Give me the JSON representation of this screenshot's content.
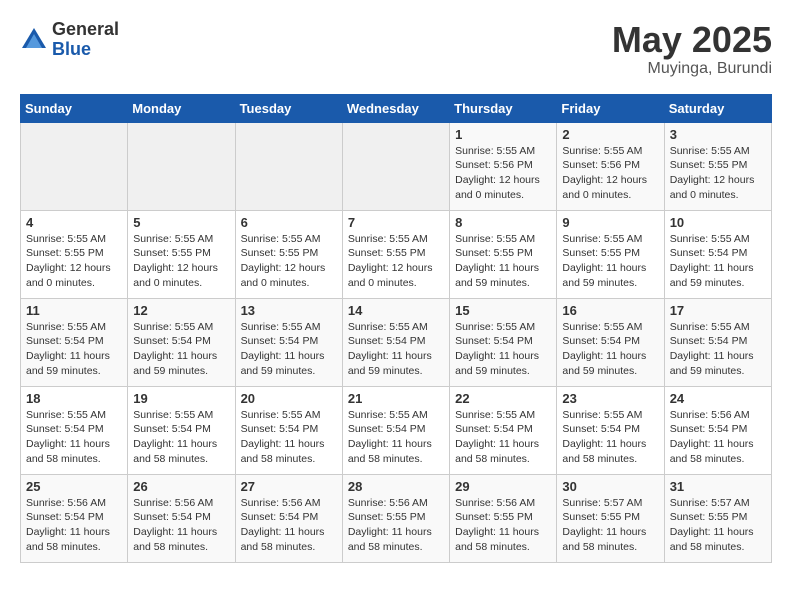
{
  "header": {
    "logo": {
      "general": "General",
      "blue": "Blue"
    },
    "month": "May 2025",
    "location": "Muyinga, Burundi"
  },
  "weekdays": [
    "Sunday",
    "Monday",
    "Tuesday",
    "Wednesday",
    "Thursday",
    "Friday",
    "Saturday"
  ],
  "weeks": [
    [
      {
        "day": "",
        "info": ""
      },
      {
        "day": "",
        "info": ""
      },
      {
        "day": "",
        "info": ""
      },
      {
        "day": "",
        "info": ""
      },
      {
        "day": "1",
        "info": "Sunrise: 5:55 AM\nSunset: 5:56 PM\nDaylight: 12 hours\nand 0 minutes."
      },
      {
        "day": "2",
        "info": "Sunrise: 5:55 AM\nSunset: 5:56 PM\nDaylight: 12 hours\nand 0 minutes."
      },
      {
        "day": "3",
        "info": "Sunrise: 5:55 AM\nSunset: 5:55 PM\nDaylight: 12 hours\nand 0 minutes."
      }
    ],
    [
      {
        "day": "4",
        "info": "Sunrise: 5:55 AM\nSunset: 5:55 PM\nDaylight: 12 hours\nand 0 minutes."
      },
      {
        "day": "5",
        "info": "Sunrise: 5:55 AM\nSunset: 5:55 PM\nDaylight: 12 hours\nand 0 minutes."
      },
      {
        "day": "6",
        "info": "Sunrise: 5:55 AM\nSunset: 5:55 PM\nDaylight: 12 hours\nand 0 minutes."
      },
      {
        "day": "7",
        "info": "Sunrise: 5:55 AM\nSunset: 5:55 PM\nDaylight: 12 hours\nand 0 minutes."
      },
      {
        "day": "8",
        "info": "Sunrise: 5:55 AM\nSunset: 5:55 PM\nDaylight: 11 hours\nand 59 minutes."
      },
      {
        "day": "9",
        "info": "Sunrise: 5:55 AM\nSunset: 5:55 PM\nDaylight: 11 hours\nand 59 minutes."
      },
      {
        "day": "10",
        "info": "Sunrise: 5:55 AM\nSunset: 5:54 PM\nDaylight: 11 hours\nand 59 minutes."
      }
    ],
    [
      {
        "day": "11",
        "info": "Sunrise: 5:55 AM\nSunset: 5:54 PM\nDaylight: 11 hours\nand 59 minutes."
      },
      {
        "day": "12",
        "info": "Sunrise: 5:55 AM\nSunset: 5:54 PM\nDaylight: 11 hours\nand 59 minutes."
      },
      {
        "day": "13",
        "info": "Sunrise: 5:55 AM\nSunset: 5:54 PM\nDaylight: 11 hours\nand 59 minutes."
      },
      {
        "day": "14",
        "info": "Sunrise: 5:55 AM\nSunset: 5:54 PM\nDaylight: 11 hours\nand 59 minutes."
      },
      {
        "day": "15",
        "info": "Sunrise: 5:55 AM\nSunset: 5:54 PM\nDaylight: 11 hours\nand 59 minutes."
      },
      {
        "day": "16",
        "info": "Sunrise: 5:55 AM\nSunset: 5:54 PM\nDaylight: 11 hours\nand 59 minutes."
      },
      {
        "day": "17",
        "info": "Sunrise: 5:55 AM\nSunset: 5:54 PM\nDaylight: 11 hours\nand 59 minutes."
      }
    ],
    [
      {
        "day": "18",
        "info": "Sunrise: 5:55 AM\nSunset: 5:54 PM\nDaylight: 11 hours\nand 58 minutes."
      },
      {
        "day": "19",
        "info": "Sunrise: 5:55 AM\nSunset: 5:54 PM\nDaylight: 11 hours\nand 58 minutes."
      },
      {
        "day": "20",
        "info": "Sunrise: 5:55 AM\nSunset: 5:54 PM\nDaylight: 11 hours\nand 58 minutes."
      },
      {
        "day": "21",
        "info": "Sunrise: 5:55 AM\nSunset: 5:54 PM\nDaylight: 11 hours\nand 58 minutes."
      },
      {
        "day": "22",
        "info": "Sunrise: 5:55 AM\nSunset: 5:54 PM\nDaylight: 11 hours\nand 58 minutes."
      },
      {
        "day": "23",
        "info": "Sunrise: 5:55 AM\nSunset: 5:54 PM\nDaylight: 11 hours\nand 58 minutes."
      },
      {
        "day": "24",
        "info": "Sunrise: 5:56 AM\nSunset: 5:54 PM\nDaylight: 11 hours\nand 58 minutes."
      }
    ],
    [
      {
        "day": "25",
        "info": "Sunrise: 5:56 AM\nSunset: 5:54 PM\nDaylight: 11 hours\nand 58 minutes."
      },
      {
        "day": "26",
        "info": "Sunrise: 5:56 AM\nSunset: 5:54 PM\nDaylight: 11 hours\nand 58 minutes."
      },
      {
        "day": "27",
        "info": "Sunrise: 5:56 AM\nSunset: 5:54 PM\nDaylight: 11 hours\nand 58 minutes."
      },
      {
        "day": "28",
        "info": "Sunrise: 5:56 AM\nSunset: 5:55 PM\nDaylight: 11 hours\nand 58 minutes."
      },
      {
        "day": "29",
        "info": "Sunrise: 5:56 AM\nSunset: 5:55 PM\nDaylight: 11 hours\nand 58 minutes."
      },
      {
        "day": "30",
        "info": "Sunrise: 5:57 AM\nSunset: 5:55 PM\nDaylight: 11 hours\nand 58 minutes."
      },
      {
        "day": "31",
        "info": "Sunrise: 5:57 AM\nSunset: 5:55 PM\nDaylight: 11 hours\nand 58 minutes."
      }
    ]
  ]
}
